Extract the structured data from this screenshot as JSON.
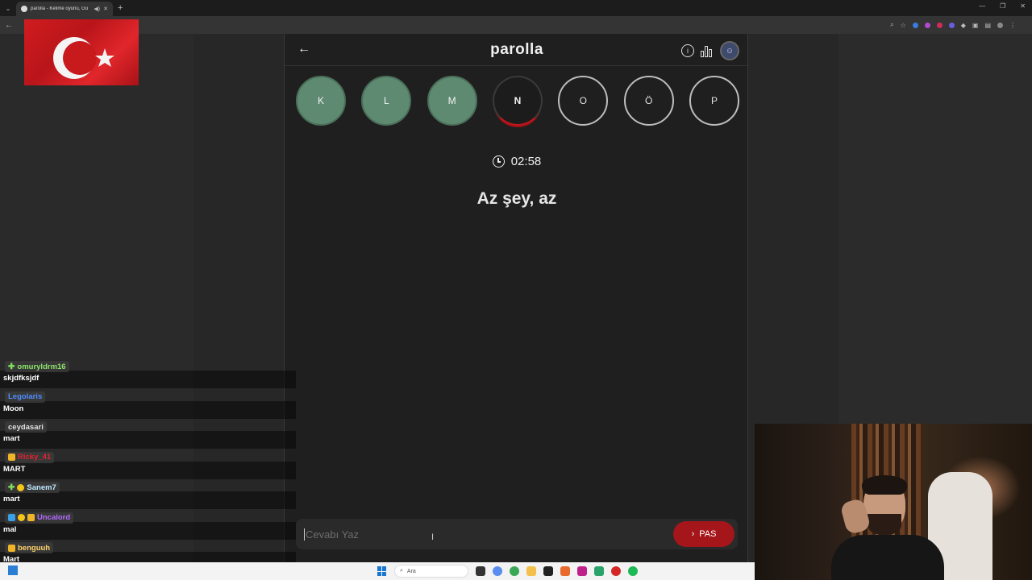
{
  "browser": {
    "tab_title": "parolla - Kelime oyunu, Gü",
    "back_icon": "arrow-left-icon",
    "new_tab": "+"
  },
  "game": {
    "title": "parolla",
    "timer": "02:58",
    "question": "Az şey, az",
    "letters": [
      {
        "letter": "K",
        "state": "correct"
      },
      {
        "letter": "L",
        "state": "correct"
      },
      {
        "letter": "M",
        "state": "correct"
      },
      {
        "letter": "N",
        "state": "active"
      },
      {
        "letter": "O",
        "state": "pending"
      },
      {
        "letter": "Ö",
        "state": "pending"
      },
      {
        "letter": "P",
        "state": "pending"
      }
    ],
    "answer_placeholder": "Cevabı Yaz",
    "answer_value": "",
    "pass_label": "PAS",
    "colors": {
      "correct": "#5d8a70",
      "active_ring": "#c0161c",
      "pass_button": "#a4161a"
    }
  },
  "chat": {
    "messages": [
      {
        "user": "omuryldrm16",
        "color": "#8be36b",
        "text": "skjdfksjdf"
      },
      {
        "user": "Legolaris",
        "color": "#4f8dff",
        "text": "Moon"
      },
      {
        "user": "ceydasari",
        "color": "#e0e0e0",
        "text": "mart"
      },
      {
        "user": "Ricky_41",
        "color": "#e0232f",
        "text": "MART"
      },
      {
        "user": "Sanem7",
        "color": "#bfe8ff",
        "text": "mart"
      },
      {
        "user": "Uncalord",
        "color": "#b36bff",
        "text": "mal"
      },
      {
        "user": "benguuh",
        "color": "#ffd36b",
        "text": "Mart"
      }
    ]
  },
  "taskbar": {
    "search_label": "Ara"
  }
}
